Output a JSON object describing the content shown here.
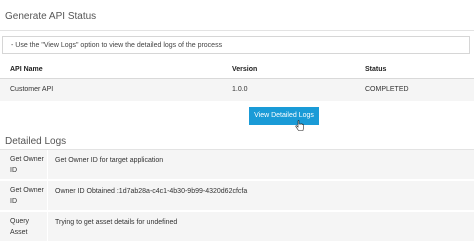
{
  "header": {
    "title": "Generate API Status"
  },
  "info": {
    "message": "- Use the \"View Logs\" option to view the detailed logs of the process"
  },
  "api_table": {
    "columns": [
      "API Name",
      "Version",
      "Status"
    ],
    "rows": [
      [
        "Customer API",
        "1.0.0",
        "COMPLETED"
      ]
    ]
  },
  "actions": {
    "view_logs_label": "View Detailed Logs"
  },
  "logs": {
    "title": "Detailed Logs",
    "entries": [
      {
        "step": "Get Owner ID",
        "message": "Get Owner ID for target application"
      },
      {
        "step": "Get Owner ID",
        "message": "Owner ID Obtained :1d7ab28a-c4c1-4b30-9b99-4320d62cfcfa"
      },
      {
        "step": "Query Asset",
        "message": "Trying to get asset details for undefined"
      }
    ]
  }
}
